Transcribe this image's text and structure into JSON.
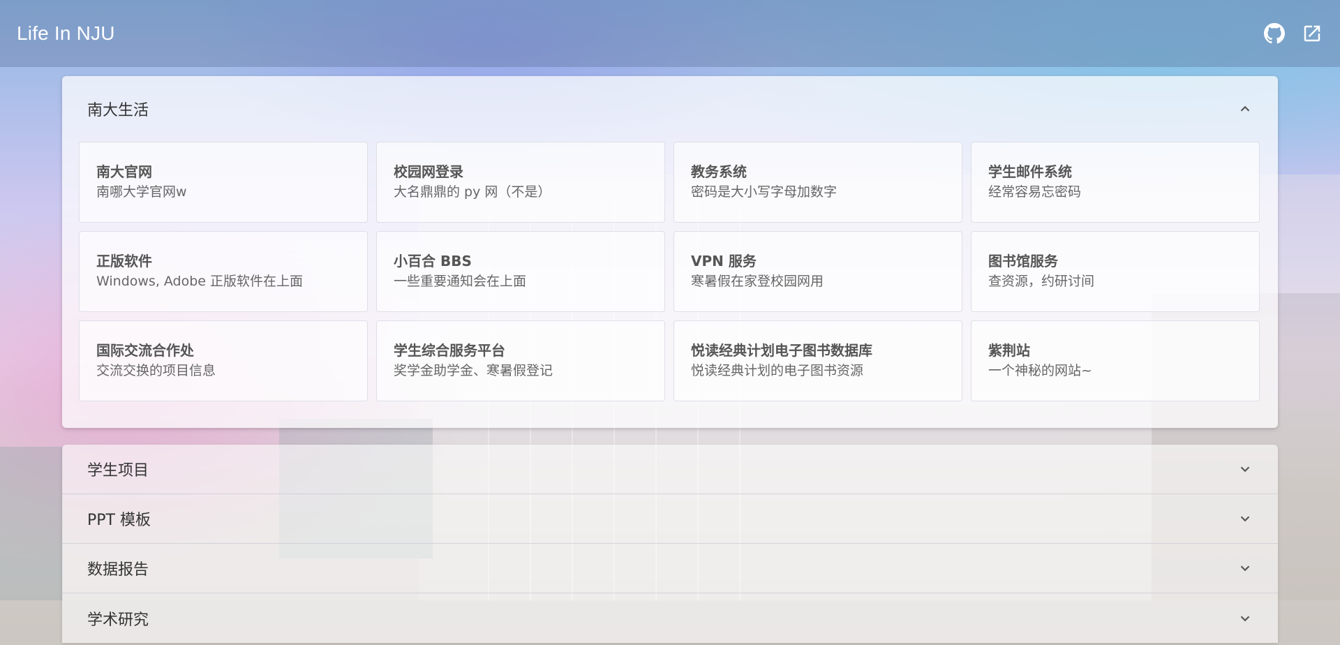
{
  "appbar": {
    "title": "Life In NJU",
    "github_icon": "github-icon",
    "open_external_icon": "open-in-new-icon"
  },
  "expanded_panel": {
    "title": "南大生活",
    "cards": [
      {
        "title": "南大官网",
        "subtitle": "南哪大学官网w"
      },
      {
        "title": "校园网登录",
        "subtitle": "大名鼎鼎的 py 网（不是）"
      },
      {
        "title": "教务系统",
        "subtitle": "密码是大小写字母加数字"
      },
      {
        "title": "学生邮件系统",
        "subtitle": "经常容易忘密码"
      },
      {
        "title": "正版软件",
        "subtitle": "Windows, Adobe 正版软件在上面"
      },
      {
        "title": "小百合 BBS",
        "subtitle": "一些重要通知会在上面"
      },
      {
        "title": "VPN 服务",
        "subtitle": "寒暑假在家登校园网用"
      },
      {
        "title": "图书馆服务",
        "subtitle": "查资源，约研讨间"
      },
      {
        "title": "国际交流合作处",
        "subtitle": "交流交换的项目信息"
      },
      {
        "title": "学生综合服务平台",
        "subtitle": "奖学金助学金、寒暑假登记"
      },
      {
        "title": "悦读经典计划电子图书数据库",
        "subtitle": "悦读经典计划的电子图书资源"
      },
      {
        "title": "紫荆站",
        "subtitle": "一个神秘的网站~"
      }
    ]
  },
  "collapsed_panels": [
    {
      "title": "学生项目"
    },
    {
      "title": "PPT 模板"
    },
    {
      "title": "数据报告"
    },
    {
      "title": "学术研究"
    }
  ]
}
